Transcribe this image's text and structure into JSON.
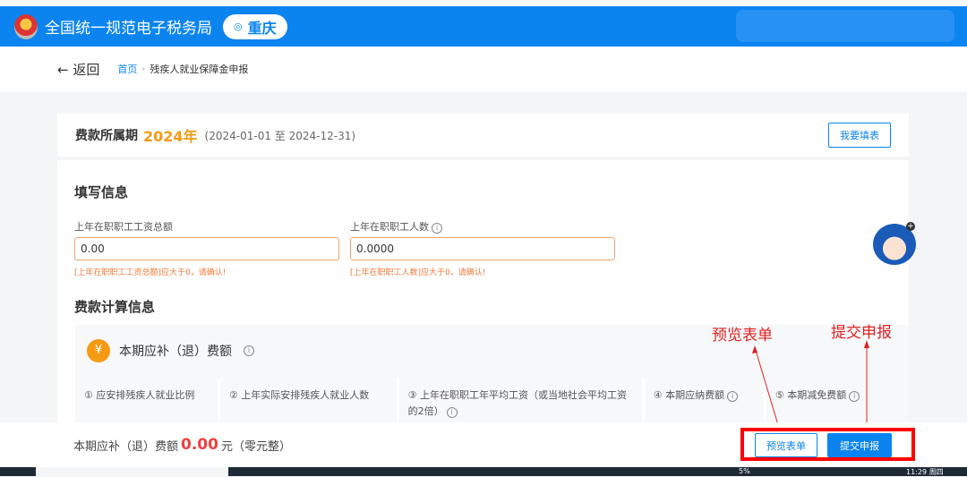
{
  "header": {
    "title": "全国统一规范电子税务局",
    "city": "重庆",
    "icons": {
      "location": "location-pin-icon",
      "emblem": "tax-emblem-icon"
    }
  },
  "nav": {
    "back": "← 返回",
    "breadcrumb": [
      "首页",
      "残疾人就业保障金申报"
    ]
  },
  "period": {
    "label": "费款所属期",
    "year": "2024年",
    "range": "(2024-01-01 至 2024-12-31)",
    "fill_button": "我要填表"
  },
  "form": {
    "section_title": "填写信息",
    "fields": [
      {
        "label": "上年在职职工工资总额",
        "value": "0.00",
        "error": "[上年在职职工工资总额]应大于0，请确认!"
      },
      {
        "label": "上年在职职工人数",
        "value": "0.0000",
        "error": "[上年在职职工人数]应大于0，请确认!"
      }
    ]
  },
  "calc": {
    "section_title": "费款计算信息",
    "head": "本期应补（退）费额",
    "columns": [
      "① 应安排残疾人就业比例",
      "② 上年实际安排残疾人就业人数",
      "③ 上年在职职工年平均工资（或当地社会平均工资的2倍）",
      "④ 本期应纳费额",
      "⑤ 本期减免费额"
    ]
  },
  "footer": {
    "label": "本期应补（退）费额",
    "amount": "0.00",
    "unit": "元",
    "words": "（零元整）",
    "preview": "预览表单",
    "submit": "提交申报"
  },
  "annotations": {
    "preview": "预览表单",
    "submit": "提交申报"
  },
  "taskbar": {
    "battery": "5%",
    "time": "11:29 周四"
  },
  "colors": {
    "brand": "#0b84f0",
    "accent": "#f59a14",
    "error": "#f07a3a",
    "amount": "#f03e3e",
    "highlight": "#ff0000"
  }
}
